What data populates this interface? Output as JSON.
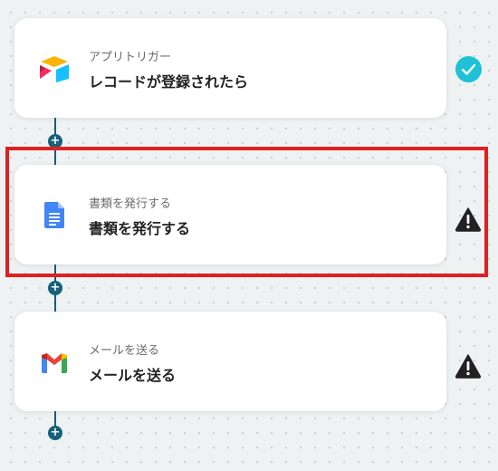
{
  "steps": [
    {
      "app": "Airtable",
      "icon": "airtable-logo-icon",
      "sublabel": "アプリトリガー",
      "title": "レコードが登録されたら",
      "status": "completed",
      "status_icon": "checkmark-icon"
    },
    {
      "app": "Google Docs",
      "icon": "google-docs-icon",
      "sublabel": "書類を発行する",
      "title": "書類を発行する",
      "status": "warning",
      "status_icon": "warning-icon",
      "highlighted": true
    },
    {
      "app": "Gmail",
      "icon": "gmail-logo-icon",
      "sublabel": "メールを送る",
      "title": "メールを送る",
      "status": "warning",
      "status_icon": "warning-icon"
    }
  ],
  "add_step_buttons": [
    {
      "label": "+",
      "icon": "plus-icon"
    },
    {
      "label": "+",
      "icon": "plus-icon"
    },
    {
      "label": "+",
      "icon": "plus-icon"
    }
  ],
  "colors": {
    "connector": "#1b5e6f",
    "add_button": "#15607a",
    "check": "#1fc0d8",
    "warning": "#222222",
    "highlight": "#e02020",
    "card": "#ffffff"
  }
}
